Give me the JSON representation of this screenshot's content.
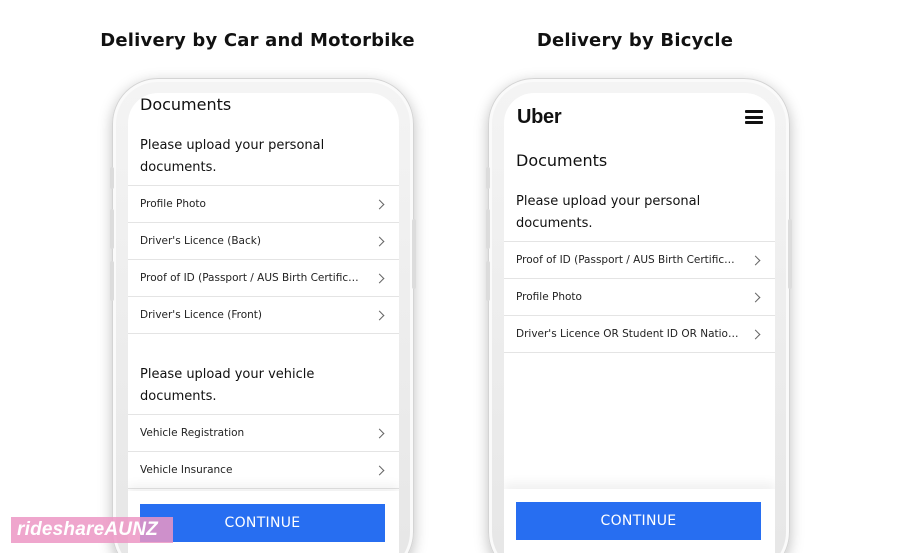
{
  "titles": {
    "left": "Delivery by Car and Motorbike",
    "right": "Delivery by Bicycle"
  },
  "left_phone": {
    "heading": "Documents",
    "personal_section_title": "Please upload your personal documents.",
    "personal_items": [
      {
        "label": "Profile Photo",
        "icon": "chevron-right-icon"
      },
      {
        "label": "Driver's Licence (Back)",
        "icon": "chevron-right-icon"
      },
      {
        "label": "Proof of ID (Passport / AUS Birth Certificate ...",
        "icon": "chevron-right-icon"
      },
      {
        "label": "Driver's Licence (Front)",
        "icon": "chevron-right-icon"
      }
    ],
    "vehicle_section_title": "Please upload your vehicle documents.",
    "vehicle_items": [
      {
        "label": "Vehicle Registration",
        "icon": "chevron-right-icon"
      },
      {
        "label": "Vehicle Insurance",
        "icon": "chevron-right-icon"
      }
    ],
    "continue_label": "CONTINUE"
  },
  "right_phone": {
    "brand": "Uber",
    "menu_icon": "hamburger-menu-icon",
    "heading": "Documents",
    "personal_section_title": "Please upload your personal documents.",
    "personal_items": [
      {
        "label": "Proof of ID (Passport / AUS Birth Certificate ...",
        "icon": "chevron-right-icon"
      },
      {
        "label": "Profile Photo",
        "icon": "chevron-right-icon"
      },
      {
        "label": "Driver's Licence OR Student ID OR National ID",
        "icon": "chevron-right-icon"
      }
    ],
    "continue_label": "CONTINUE"
  },
  "watermark": "rideshareAUNZ",
  "colors": {
    "accent": "#276ef1",
    "watermark_bg": "#ec96c4"
  }
}
